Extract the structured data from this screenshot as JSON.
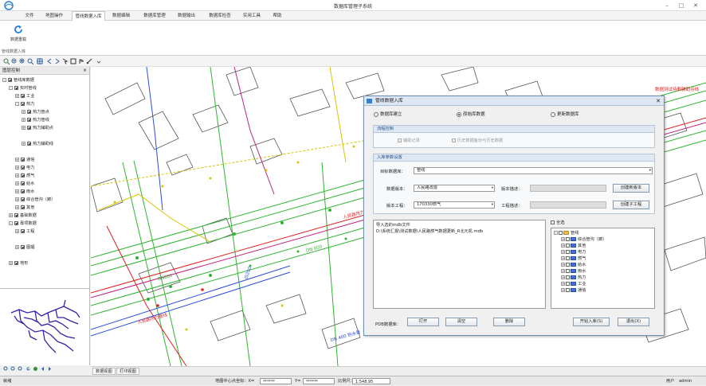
{
  "app": {
    "title": "数据库管理子系统"
  },
  "window": {
    "minimize": "–",
    "maximize": "□",
    "close": "✕"
  },
  "menu": [
    "文件",
    "地图操作",
    "管线数据入库",
    "数据编辑",
    "数据库管理",
    "数据输出",
    "数据库检查",
    "实用工具",
    "帮助"
  ],
  "menu_active_index": 2,
  "ribbon": {
    "button_label": "数据重载",
    "group_label": "管线数据入库"
  },
  "toolbar_icons": [
    "zoom-in-icon",
    "zoom-out-icon",
    "pan-icon",
    "full-extent-icon",
    "prev-view-icon",
    "next-view-icon",
    "refresh-icon",
    "select-icon",
    "identify-icon",
    "measure-icon",
    "clear-icon"
  ],
  "left_panel": {
    "title": "图层控制",
    "close": "×",
    "tree": [
      {
        "label": "管线库数据",
        "level": 0
      },
      {
        "label": "实时管线",
        "level": 1
      },
      {
        "label": "工业",
        "level": 2
      },
      {
        "label": "热力",
        "level": 2
      },
      {
        "label": "热力管点",
        "level": 3
      },
      {
        "label": "热力管线",
        "level": 3
      },
      {
        "label": "热力辅助点",
        "level": 3
      },
      {
        "label": "热力辅助线",
        "level": 3
      },
      {
        "label": "通信",
        "level": 2
      },
      {
        "label": "电力",
        "level": 2
      },
      {
        "label": "燃气",
        "level": 2
      },
      {
        "label": "给水",
        "level": 2
      },
      {
        "label": "雨水",
        "level": 2
      },
      {
        "label": "综合管沟（廊）",
        "level": 2
      },
      {
        "label": "其他",
        "level": 2
      },
      {
        "label": "基础数据",
        "level": 1
      },
      {
        "label": "專项数据",
        "level": 1
      },
      {
        "label": "工程",
        "level": 2
      },
      {
        "label": "图幅",
        "level": 2
      },
      {
        "label": "地形",
        "level": 1
      }
    ]
  },
  "tabs": [
    "数据视图",
    "打印视图"
  ],
  "status": {
    "left": "就绪",
    "center_label": "地图中心点坐标：X=",
    "x": "******",
    "y_label": "Y=",
    "y": "******",
    "scale_label": "比例尺：",
    "scale": "1:548.95",
    "user_label": "用户",
    "user": "admin"
  },
  "map_labels": {
    "top_right": "数据测试待删辅助点线",
    "red_center": "人民路热力管线",
    "red_left": "人民路热力管线",
    "green_a": "DN 800",
    "green_b": "DN600",
    "blue_a": "JS200",
    "cyan_a": "DN 400 热水管"
  },
  "dialog": {
    "title": "管线数据入库",
    "close": "✕",
    "radios": [
      {
        "label": "数据库建立",
        "on": false
      },
      {
        "label": "原始库数据",
        "on": true
      },
      {
        "label": "更新数据库",
        "on": false
      }
    ],
    "process_group": {
      "title": "流程控制",
      "opt1": "辅助记录",
      "opt2": "历史数据备份与历史数据"
    },
    "import_group": {
      "title": "入库参数设置",
      "target_label": "目标数据库：",
      "target_value": "管线",
      "version_label": "数据版本：",
      "version_value": "人民路改造",
      "version_desc_label": "版本描述：",
      "new_version_btn": "创建新版本",
      "project_label": "版本工程：",
      "project_value": "170330燃气",
      "project_desc_label": "工程描述：",
      "new_project_btn": "创建子工程"
    },
    "file_text_line1": "导入选的mdb文件",
    "file_text_line2": "D:\\系统汇报\\测试数据\\人民路燃气数据更新_R北元机.mdb",
    "select_all": "全选",
    "layer_tree": [
      "管线",
      "综合管沟（廊）",
      "其他",
      "电力",
      "燃气",
      "给水",
      "雨水",
      "热力",
      "工业",
      "通信"
    ],
    "bottom": {
      "pdb_label": "PDB数据库：",
      "open_btn": "打开",
      "clear_btn": "清空",
      "delete_btn": "删除",
      "start_btn": "开始入库(S)",
      "exit_btn": "退出(X)"
    }
  },
  "colors": {
    "accent": "#3a7fc9",
    "map_green": "#2fb52f",
    "map_red": "#e02020",
    "map_blue": "#2b4fd8",
    "map_yellow": "#d8c400",
    "overview_purple": "#3a1fa8"
  }
}
